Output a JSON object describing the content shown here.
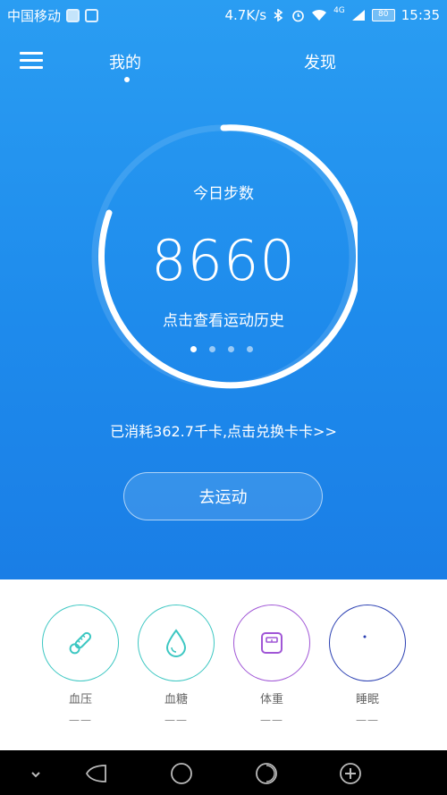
{
  "status_bar": {
    "carrier": "中国移动",
    "speed": "4.7K/s",
    "network": "4G",
    "battery": "80",
    "time": "15:35"
  },
  "nav": {
    "tabs": [
      {
        "label": "我的",
        "active": true
      },
      {
        "label": "发现",
        "active": false
      }
    ]
  },
  "ring": {
    "title": "今日步数",
    "steps": "8660",
    "history_link": "点击查看运动历史",
    "pages": 4,
    "active_page": 0
  },
  "calories_text": "已消耗362.7千卡,点击兑换卡卡>>",
  "go_button": "去运动",
  "health": [
    {
      "label": "血压",
      "value": "——",
      "icon": "thermometer-icon",
      "color": "#3cc7c2"
    },
    {
      "label": "血糖",
      "value": "——",
      "icon": "water-drop-icon",
      "color": "#3cc7c2"
    },
    {
      "label": "体重",
      "value": "——",
      "icon": "scale-icon",
      "color": "#a056d6"
    },
    {
      "label": "睡眠",
      "value": "——",
      "icon": "moon-icon",
      "color": "#2a3fb2"
    }
  ],
  "colors": {
    "accent": "#1e8bec",
    "teal": "#3cc7c2",
    "purple": "#a056d6",
    "navy": "#2a3fb2"
  }
}
